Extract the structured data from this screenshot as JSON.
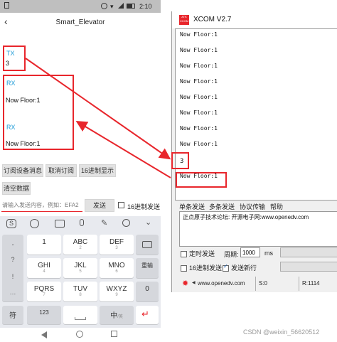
{
  "phone": {
    "statusbar": {
      "left_text": "□",
      "time": "2:10"
    },
    "appbar": {
      "title": "Smart_Elevator"
    },
    "tx": {
      "label": "TX",
      "value": "3"
    },
    "rx": [
      {
        "label": "RX",
        "value": "Now Floor:1"
      },
      {
        "label": "RX",
        "value": "Now Floor:1"
      }
    ],
    "buttons": {
      "subscribe": "订阅设备消息",
      "unsubscribe": "取消订阅",
      "hex_display": "16进制显示",
      "clear": "清空数据"
    },
    "send": {
      "placeholder": "请输入发送内容，例如：EFA2",
      "send_label": "发送",
      "hex_send_label": "16进制发送"
    },
    "keyboard": {
      "toolbar_icons": [
        "sogou-icon",
        "emoji-icon",
        "keyboard-icon",
        "mic-icon",
        "handwriting-icon",
        "search-icon",
        "collapse-icon"
      ],
      "row1": [
        {
          "main": "1",
          "sub": ""
        },
        {
          "main": "ABC",
          "sub": "2"
        },
        {
          "main": "DEF",
          "sub": "3"
        }
      ],
      "row2": [
        {
          "main": "GHI",
          "sub": "4"
        },
        {
          "main": "JKL",
          "sub": "5"
        },
        {
          "main": "MNO",
          "sub": "6"
        }
      ],
      "row3": [
        {
          "main": "PQRS",
          "sub": "7"
        },
        {
          "main": "TUV",
          "sub": "8"
        },
        {
          "main": "WXYZ",
          "sub": "9"
        }
      ],
      "left_col": [
        ",",
        "?",
        "!",
        "…"
      ],
      "reset": "重输",
      "zero": "0",
      "symbols": "符",
      "num": "123",
      "lang_main": "中",
      "lang_sub": "/英"
    }
  },
  "xcom": {
    "title": "XCOM V2.7",
    "logo_text": "ATK\nXCOM",
    "receive_lines": [
      "Now Floor:1",
      "Now Floor:1",
      "Now Floor:1",
      "Now Floor:1",
      "Now Floor:1",
      "Now Floor:1",
      "Now Floor:1",
      "Now Floor:1",
      "3",
      "Now Floor:1"
    ],
    "tabs": [
      "单条发送",
      "多条发送",
      "协议传输",
      "帮助"
    ],
    "send_text": "正点原子技术论坛: 开源电子网:www.openedv.com",
    "timed_send_label": "定时发送",
    "period_label": "周期:",
    "period_value": "1000",
    "period_unit": "ms",
    "hex_send_label": "16进制发送",
    "newline_label": "发送新行",
    "status_url": "www.openedv.com",
    "status_s": "S:0",
    "status_r": "R:1114"
  },
  "watermark": "CSDN @weixin_56620512",
  "colors": {
    "accent": "#1e9bd7",
    "highlight": "#e8262c"
  }
}
